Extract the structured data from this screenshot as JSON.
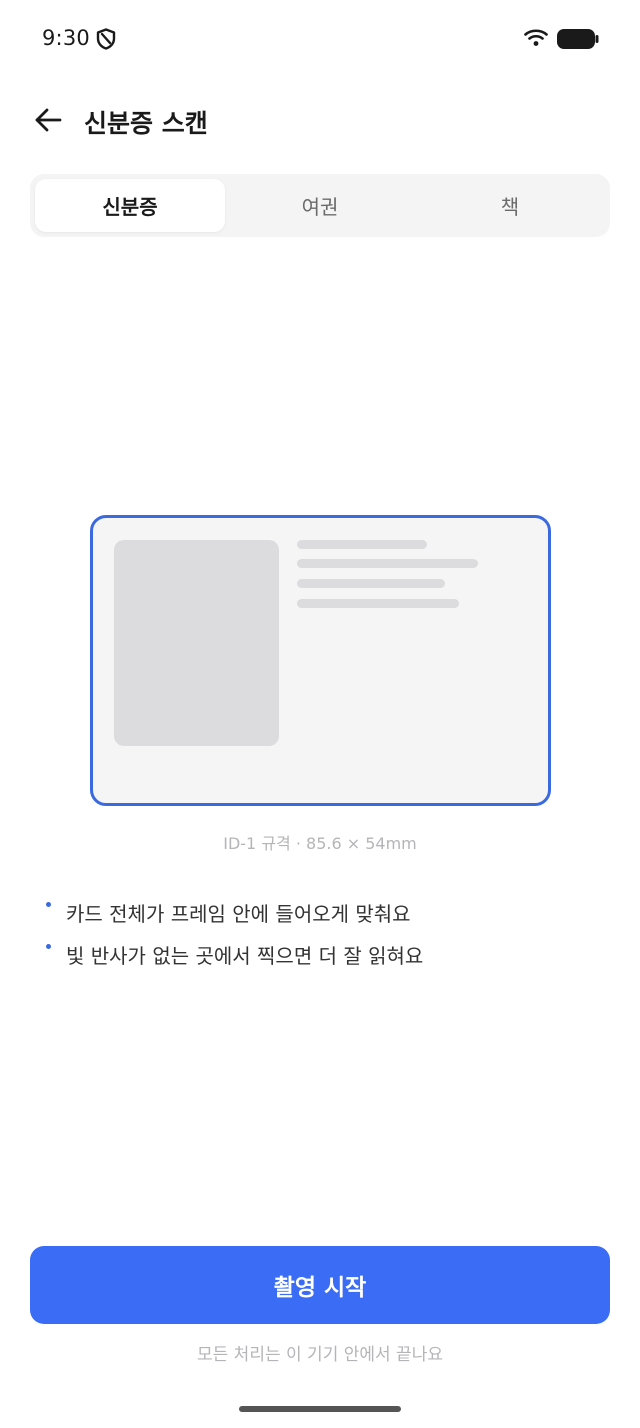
{
  "status_bar": {
    "time": "9:30",
    "icons": [
      "shield-icon",
      "wifi-icon",
      "battery-icon"
    ]
  },
  "header": {
    "back_icon": "arrow-left-icon",
    "title": "신분증 스캔"
  },
  "tabs": [
    {
      "label": "신분증",
      "active": true
    },
    {
      "label": "여권",
      "active": false
    },
    {
      "label": "책",
      "active": false
    }
  ],
  "card": {
    "caption": "ID-1 규격 · 85.6 × 54mm"
  },
  "tips": [
    "카드 전체가 프레임 안에 들어오게 맞춰요",
    "빛 반사가 없는 곳에서 찍으면 더 잘 읽혀요"
  ],
  "actions": {
    "start_label": "촬영 시작",
    "footnote": "모든 처리는 이 기기 안에서 끝나요"
  },
  "colors": {
    "accent": "#3b6cf6",
    "frame": "#3b6ae0",
    "muted": "#b5b5b8"
  }
}
